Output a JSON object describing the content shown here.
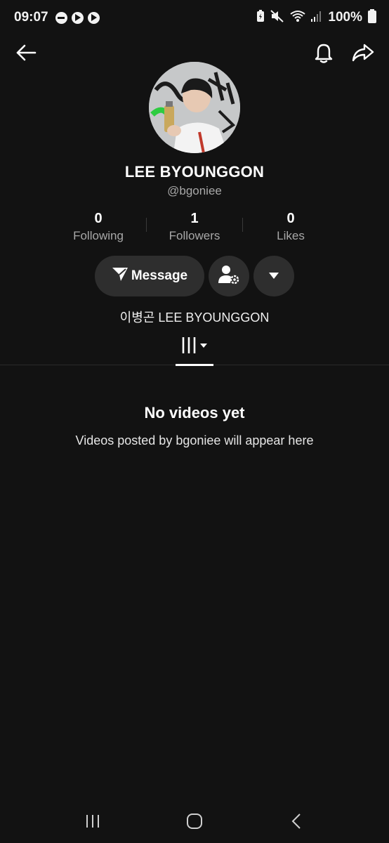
{
  "status_bar": {
    "time": "09:07",
    "battery": "100%",
    "icons": [
      "dnd-icon",
      "play-icon",
      "play-icon",
      "battery-saver-icon",
      "mute-icon",
      "wifi-icon",
      "signal-icon",
      "battery-icon"
    ]
  },
  "top_nav": {
    "back_icon": "arrow-left-icon",
    "notify_icon": "bell-icon",
    "share_icon": "share-icon"
  },
  "profile": {
    "display_name": "LEE BYOUNGGON",
    "username": "@bgoniee",
    "bio": "이병곤 LEE BYOUNGGON",
    "stats": [
      {
        "value": "0",
        "label": "Following"
      },
      {
        "value": "1",
        "label": "Followers"
      },
      {
        "value": "0",
        "label": "Likes"
      }
    ],
    "actions": {
      "message_label": "Message"
    }
  },
  "tabs": {
    "active_icon": "videos-grid-icon"
  },
  "empty_state": {
    "title": "No videos yet",
    "subtitle": "Videos posted by bgoniee will appear here"
  },
  "colors": {
    "background": "#121212",
    "button_bg": "#2e2e2e",
    "secondary_text": "#a8a8a8"
  }
}
